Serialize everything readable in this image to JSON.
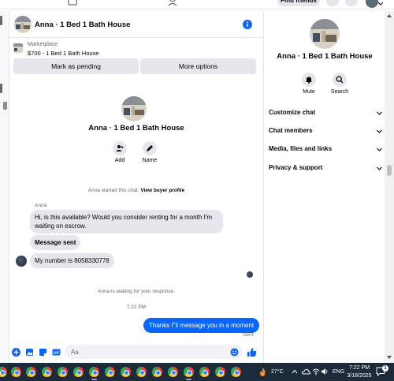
{
  "topbar": {
    "find_friends": "Find friends"
  },
  "header": {
    "title": "Anna · 1 Bed 1 Bath House"
  },
  "marketplace": {
    "label": "Marketplace",
    "listing": "$700 - 1 Bed 1 Bath House",
    "mark_pending": "Mark as pending",
    "more_options": "More options"
  },
  "profile": {
    "name": "Anna · 1 Bed 1 Bath House",
    "add": "Add",
    "name_action": "Name"
  },
  "conversation": {
    "started": "Anna started this chat.",
    "view_profile": "View buyer profile",
    "sender": "Anna",
    "msg1": "Hi, is this available? Would you consider renting for a month I'm waiting on escrow.",
    "msg2": "Message sent",
    "msg3": "My number is 8058330778",
    "waiting": "Anna is waiting for your response.",
    "time": "7:22 PM",
    "reply": "Thanks I\"ll message you in a moment",
    "status": "Sent"
  },
  "composer": {
    "placeholder": "Aa"
  },
  "right_panel": {
    "name": "Anna · 1 Bed 1 Bath House",
    "mute": "Mute",
    "search": "Search",
    "sections": [
      "Customize chat",
      "Chat members",
      "Media, files and links",
      "Privacy & support"
    ]
  },
  "taskbar": {
    "temperature": "27°C",
    "lang": "ENG",
    "time": "7:22 PM",
    "date": "3/18/2025",
    "notification_count": "1"
  },
  "colors": {
    "accent": "#0866ff",
    "bubble_in": "#e4e6eb",
    "taskbar": "#1d2a3a"
  },
  "icons": [
    "marketplace-icon",
    "people-icon",
    "grid-menu-icon",
    "bell-icon",
    "info-icon",
    "add-person-icon",
    "pencil-icon",
    "mute-bell-icon",
    "search-icon",
    "chevron-down-icon",
    "plus-icon",
    "photo-icon",
    "sticker-icon",
    "gif-icon",
    "emoji-icon",
    "like-icon",
    "chrome-icon",
    "weather-icon",
    "wifi-icon",
    "speaker-icon",
    "notifications-icon"
  ]
}
